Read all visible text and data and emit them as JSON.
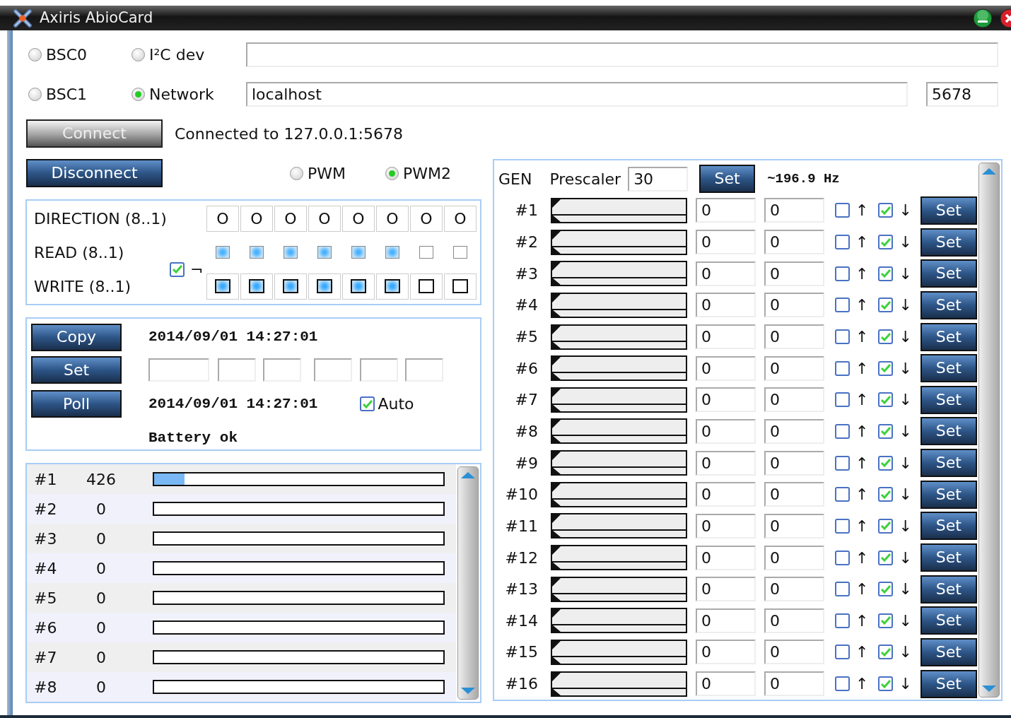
{
  "window": {
    "title": "Axiris AbioCard"
  },
  "interfaces": [
    {
      "label": "BSC0",
      "selected": false
    },
    {
      "label": "I²C dev",
      "selected": false
    },
    {
      "label": "BSC1",
      "selected": false
    },
    {
      "label": "Network",
      "selected": true
    }
  ],
  "host": {
    "value": "localhost"
  },
  "port": {
    "value": "5678"
  },
  "connect_button": {
    "label": "Connect",
    "disabled": true
  },
  "connection_status": "Connected to 127.0.0.1:5678",
  "disconnect_button": {
    "label": "Disconnect",
    "disabled": false
  },
  "pwm_modes": [
    {
      "label": "PWM",
      "selected": false
    },
    {
      "label": "PWM2",
      "selected": true
    }
  ],
  "io": {
    "direction_label": "DIRECTION (8..1)",
    "read_label": "READ (8..1)",
    "write_label": "WRITE (8..1)",
    "link": {
      "checked": true,
      "symbol": "¬"
    },
    "direction": [
      "O",
      "O",
      "O",
      "O",
      "O",
      "O",
      "O",
      "O"
    ],
    "read": [
      {
        "on": true
      },
      {
        "on": true
      },
      {
        "on": true
      },
      {
        "on": true
      },
      {
        "on": true
      },
      {
        "on": true
      },
      {
        "on": false
      },
      {
        "on": false
      }
    ],
    "write": [
      {
        "checked": true
      },
      {
        "checked": true
      },
      {
        "checked": true
      },
      {
        "checked": true
      },
      {
        "checked": true
      },
      {
        "checked": true
      },
      {
        "checked": false
      },
      {
        "checked": false
      }
    ]
  },
  "rtc": {
    "buttons": [
      "Copy",
      "Set",
      "Poll"
    ],
    "pc_time": "2014/09/01 14:27:01",
    "rtc_time": "2014/09/01 14:27:01",
    "auto": {
      "label": "Auto",
      "checked": true
    },
    "battery": "Battery ok"
  },
  "adc": {
    "channels": [
      {
        "label": "#1",
        "reading": "426",
        "level": 0.104
      },
      {
        "label": "#2",
        "reading": "0",
        "level": 0
      },
      {
        "label": "#3",
        "reading": "0",
        "level": 0
      },
      {
        "label": "#4",
        "reading": "0",
        "level": 0
      },
      {
        "label": "#5",
        "reading": "0",
        "level": 0
      },
      {
        "label": "#6",
        "reading": "0",
        "level": 0
      },
      {
        "label": "#7",
        "reading": "0",
        "level": 0
      },
      {
        "label": "#8",
        "reading": "0",
        "level": 0
      }
    ]
  },
  "gen": {
    "label": "GEN",
    "prescaler_label": "Prescaler",
    "prescaler": "30",
    "set_button": "Set",
    "frequency": "~196.9 Hz",
    "channels": [
      {
        "label": "#1",
        "level": 0,
        "value_1": "0",
        "value_2": "0",
        "rise": {
          "checked": false,
          "symbol": "↑"
        },
        "fall": {
          "checked": true,
          "symbol": "↓"
        },
        "button": "Set"
      },
      {
        "label": "#2",
        "level": 0,
        "value_1": "0",
        "value_2": "0",
        "rise": {
          "checked": false,
          "symbol": "↑"
        },
        "fall": {
          "checked": true,
          "symbol": "↓"
        },
        "button": "Set"
      },
      {
        "label": "#3",
        "level": 0,
        "value_1": "0",
        "value_2": "0",
        "rise": {
          "checked": false,
          "symbol": "↑"
        },
        "fall": {
          "checked": true,
          "symbol": "↓"
        },
        "button": "Set"
      },
      {
        "label": "#4",
        "level": 0,
        "value_1": "0",
        "value_2": "0",
        "rise": {
          "checked": false,
          "symbol": "↑"
        },
        "fall": {
          "checked": true,
          "symbol": "↓"
        },
        "button": "Set"
      },
      {
        "label": "#5",
        "level": 0,
        "value_1": "0",
        "value_2": "0",
        "rise": {
          "checked": false,
          "symbol": "↑"
        },
        "fall": {
          "checked": true,
          "symbol": "↓"
        },
        "button": "Set"
      },
      {
        "label": "#6",
        "level": 0,
        "value_1": "0",
        "value_2": "0",
        "rise": {
          "checked": false,
          "symbol": "↑"
        },
        "fall": {
          "checked": true,
          "symbol": "↓"
        },
        "button": "Set"
      },
      {
        "label": "#7",
        "level": 0,
        "value_1": "0",
        "value_2": "0",
        "rise": {
          "checked": false,
          "symbol": "↑"
        },
        "fall": {
          "checked": true,
          "symbol": "↓"
        },
        "button": "Set"
      },
      {
        "label": "#8",
        "level": 0,
        "value_1": "0",
        "value_2": "0",
        "rise": {
          "checked": false,
          "symbol": "↑"
        },
        "fall": {
          "checked": true,
          "symbol": "↓"
        },
        "button": "Set"
      },
      {
        "label": "#9",
        "level": 0,
        "value_1": "0",
        "value_2": "0",
        "rise": {
          "checked": false,
          "symbol": "↑"
        },
        "fall": {
          "checked": true,
          "symbol": "↓"
        },
        "button": "Set"
      },
      {
        "label": "#10",
        "level": 0,
        "value_1": "0",
        "value_2": "0",
        "rise": {
          "checked": false,
          "symbol": "↑"
        },
        "fall": {
          "checked": true,
          "symbol": "↓"
        },
        "button": "Set"
      },
      {
        "label": "#11",
        "level": 0,
        "value_1": "0",
        "value_2": "0",
        "rise": {
          "checked": false,
          "symbol": "↑"
        },
        "fall": {
          "checked": true,
          "symbol": "↓"
        },
        "button": "Set"
      },
      {
        "label": "#12",
        "level": 0,
        "value_1": "0",
        "value_2": "0",
        "rise": {
          "checked": false,
          "symbol": "↑"
        },
        "fall": {
          "checked": true,
          "symbol": "↓"
        },
        "button": "Set"
      },
      {
        "label": "#13",
        "level": 0,
        "value_1": "0",
        "value_2": "0",
        "rise": {
          "checked": false,
          "symbol": "↑"
        },
        "fall": {
          "checked": true,
          "symbol": "↓"
        },
        "button": "Set"
      },
      {
        "label": "#14",
        "level": 0,
        "value_1": "0",
        "value_2": "0",
        "rise": {
          "checked": false,
          "symbol": "↑"
        },
        "fall": {
          "checked": true,
          "symbol": "↓"
        },
        "button": "Set"
      },
      {
        "label": "#15",
        "level": 0,
        "value_1": "0",
        "value_2": "0",
        "rise": {
          "checked": false,
          "symbol": "↑"
        },
        "fall": {
          "checked": true,
          "symbol": "↓"
        },
        "button": "Set"
      },
      {
        "label": "#16",
        "level": 0,
        "value_1": "0",
        "value_2": "0",
        "rise": {
          "checked": false,
          "symbol": "↑"
        },
        "fall": {
          "checked": true,
          "symbol": "↓"
        },
        "button": "Set"
      }
    ]
  }
}
